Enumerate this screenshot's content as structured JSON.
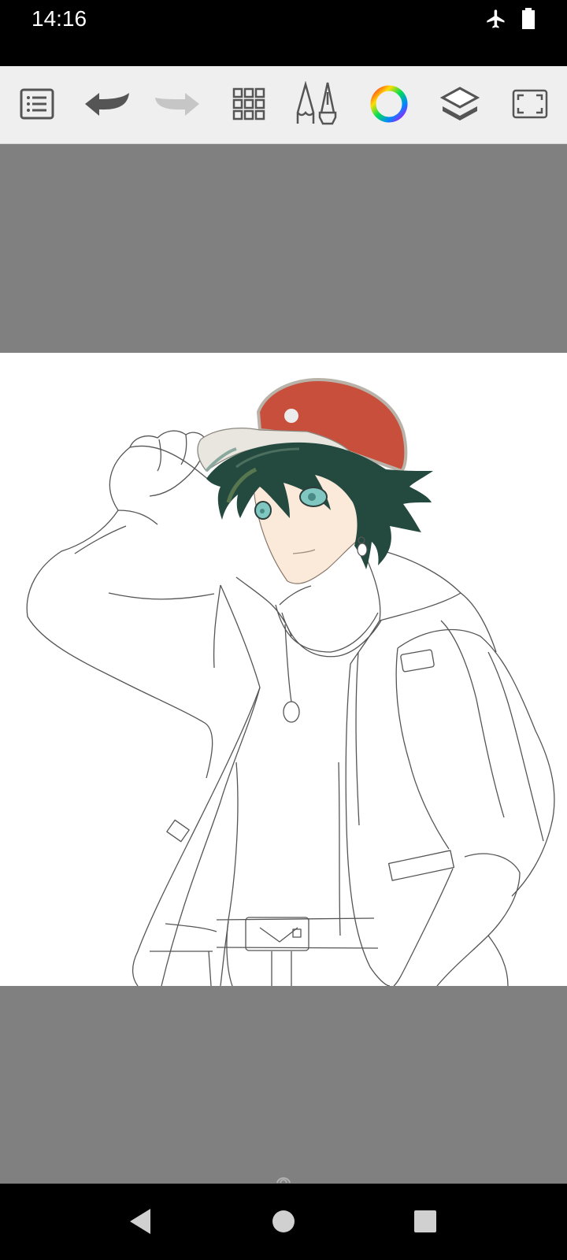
{
  "status_bar": {
    "time": "14:16",
    "icons": [
      "airplane-mode-icon",
      "battery-icon"
    ]
  },
  "toolbar": {
    "tools": [
      "menu-list-icon",
      "undo-icon",
      "redo-icon",
      "grid-icon",
      "brush-pen-icon",
      "color-wheel-icon",
      "layers-icon",
      "fullscreen-icon"
    ],
    "redo_enabled": false
  },
  "canvas": {
    "background": "#ffffff",
    "cap_color": "#c84f3b",
    "hair_color": "#244a40",
    "eye_color": "#7fc7c0",
    "skin_color": "#fbe9da"
  },
  "nav_bar": {
    "buttons": [
      "back-icon",
      "home-icon",
      "recents-icon"
    ]
  }
}
